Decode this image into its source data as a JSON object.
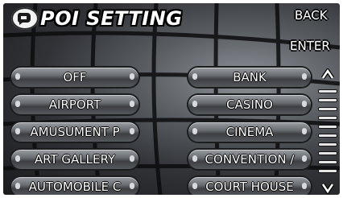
{
  "header": {
    "title": "POI SETTING",
    "icon": "poi-badge-icon"
  },
  "nav": {
    "back_label": "BACK",
    "enter_label": "ENTER",
    "up_icon": "chevron-up-icon",
    "down_icon": "chevron-down-icon"
  },
  "left_column": [
    {
      "label": "OFF"
    },
    {
      "label": "AIRPORT"
    },
    {
      "label": "AMUSUMENT P"
    },
    {
      "label": "ART GALLERY"
    },
    {
      "label": "AUTOMOBILE C"
    }
  ],
  "right_column": [
    {
      "label": "BANK"
    },
    {
      "label": "CASINO"
    },
    {
      "label": "CINEMA"
    },
    {
      "label": "CONVENTION  /"
    },
    {
      "label": "COURT  HOUSE"
    }
  ],
  "colors": {
    "button_text": "#ffffff",
    "background_dark": "#1a1b1d",
    "background_light": "#8e9298"
  }
}
